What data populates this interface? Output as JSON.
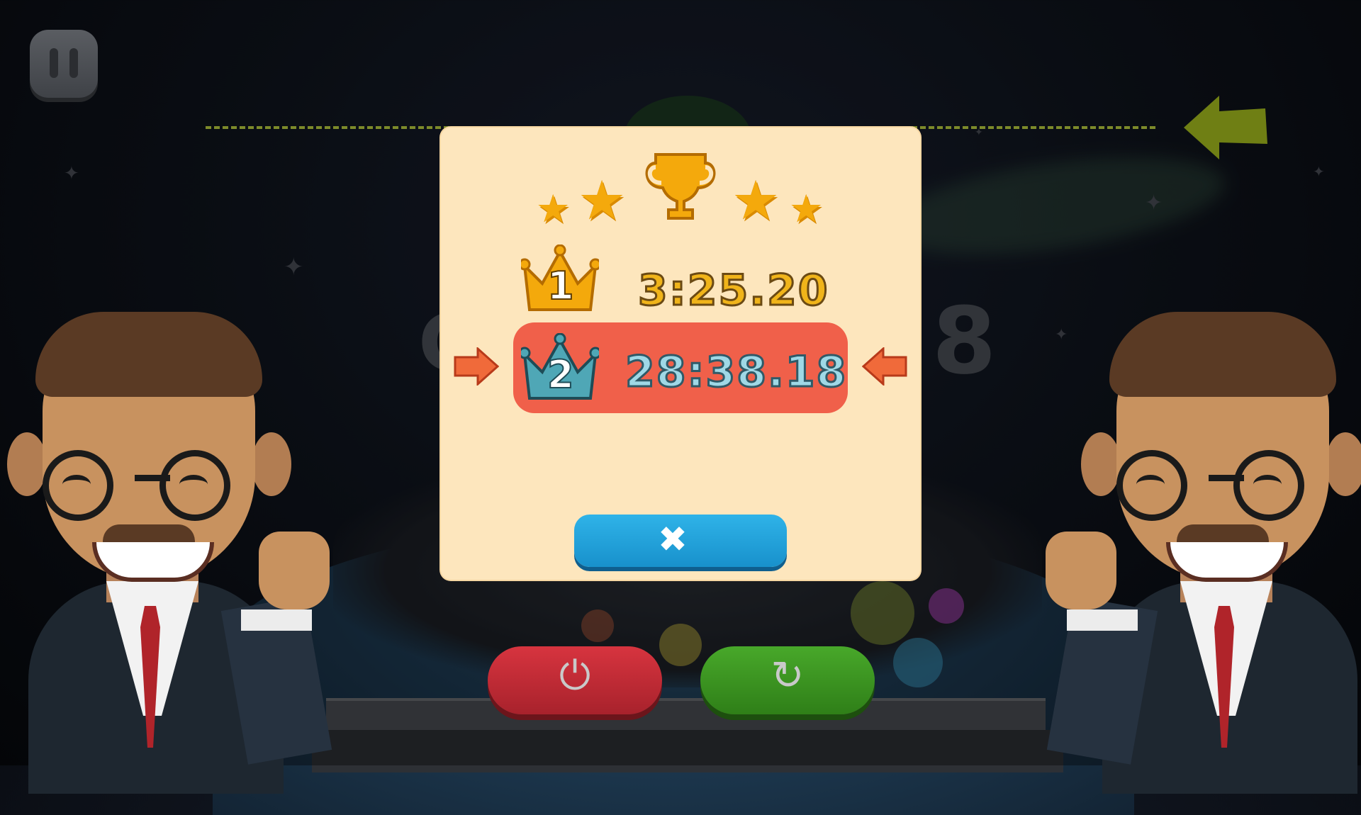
{
  "hud": {
    "pause_icon": "pause-icon",
    "goal_arrow_icon": "arrow-left-icon",
    "background_digit": "8",
    "background_letter": "C"
  },
  "modal": {
    "trophy_icon": "trophy-icon",
    "star_icon": "star-icon",
    "rank1": {
      "rank": "1",
      "time": "3:25.20",
      "crown_color": "#f4a90c"
    },
    "rank2": {
      "rank": "2",
      "time": "28:38.18",
      "crown_color": "#4fa7b6",
      "highlight_color": "#f0604a"
    },
    "pointer_icon": "pointer-arrow-icon",
    "close_glyph": "✖"
  },
  "buttons": {
    "power_glyph": "⏻",
    "retry_glyph": "↻"
  },
  "colors": {
    "modal_bg": "#fde6bd",
    "close_button": "#1fa3dc",
    "power_button": "#c62b35",
    "retry_button": "#3e9a23",
    "rank1_text": "#f0b41a",
    "rank2_text": "#9fd8e6"
  }
}
